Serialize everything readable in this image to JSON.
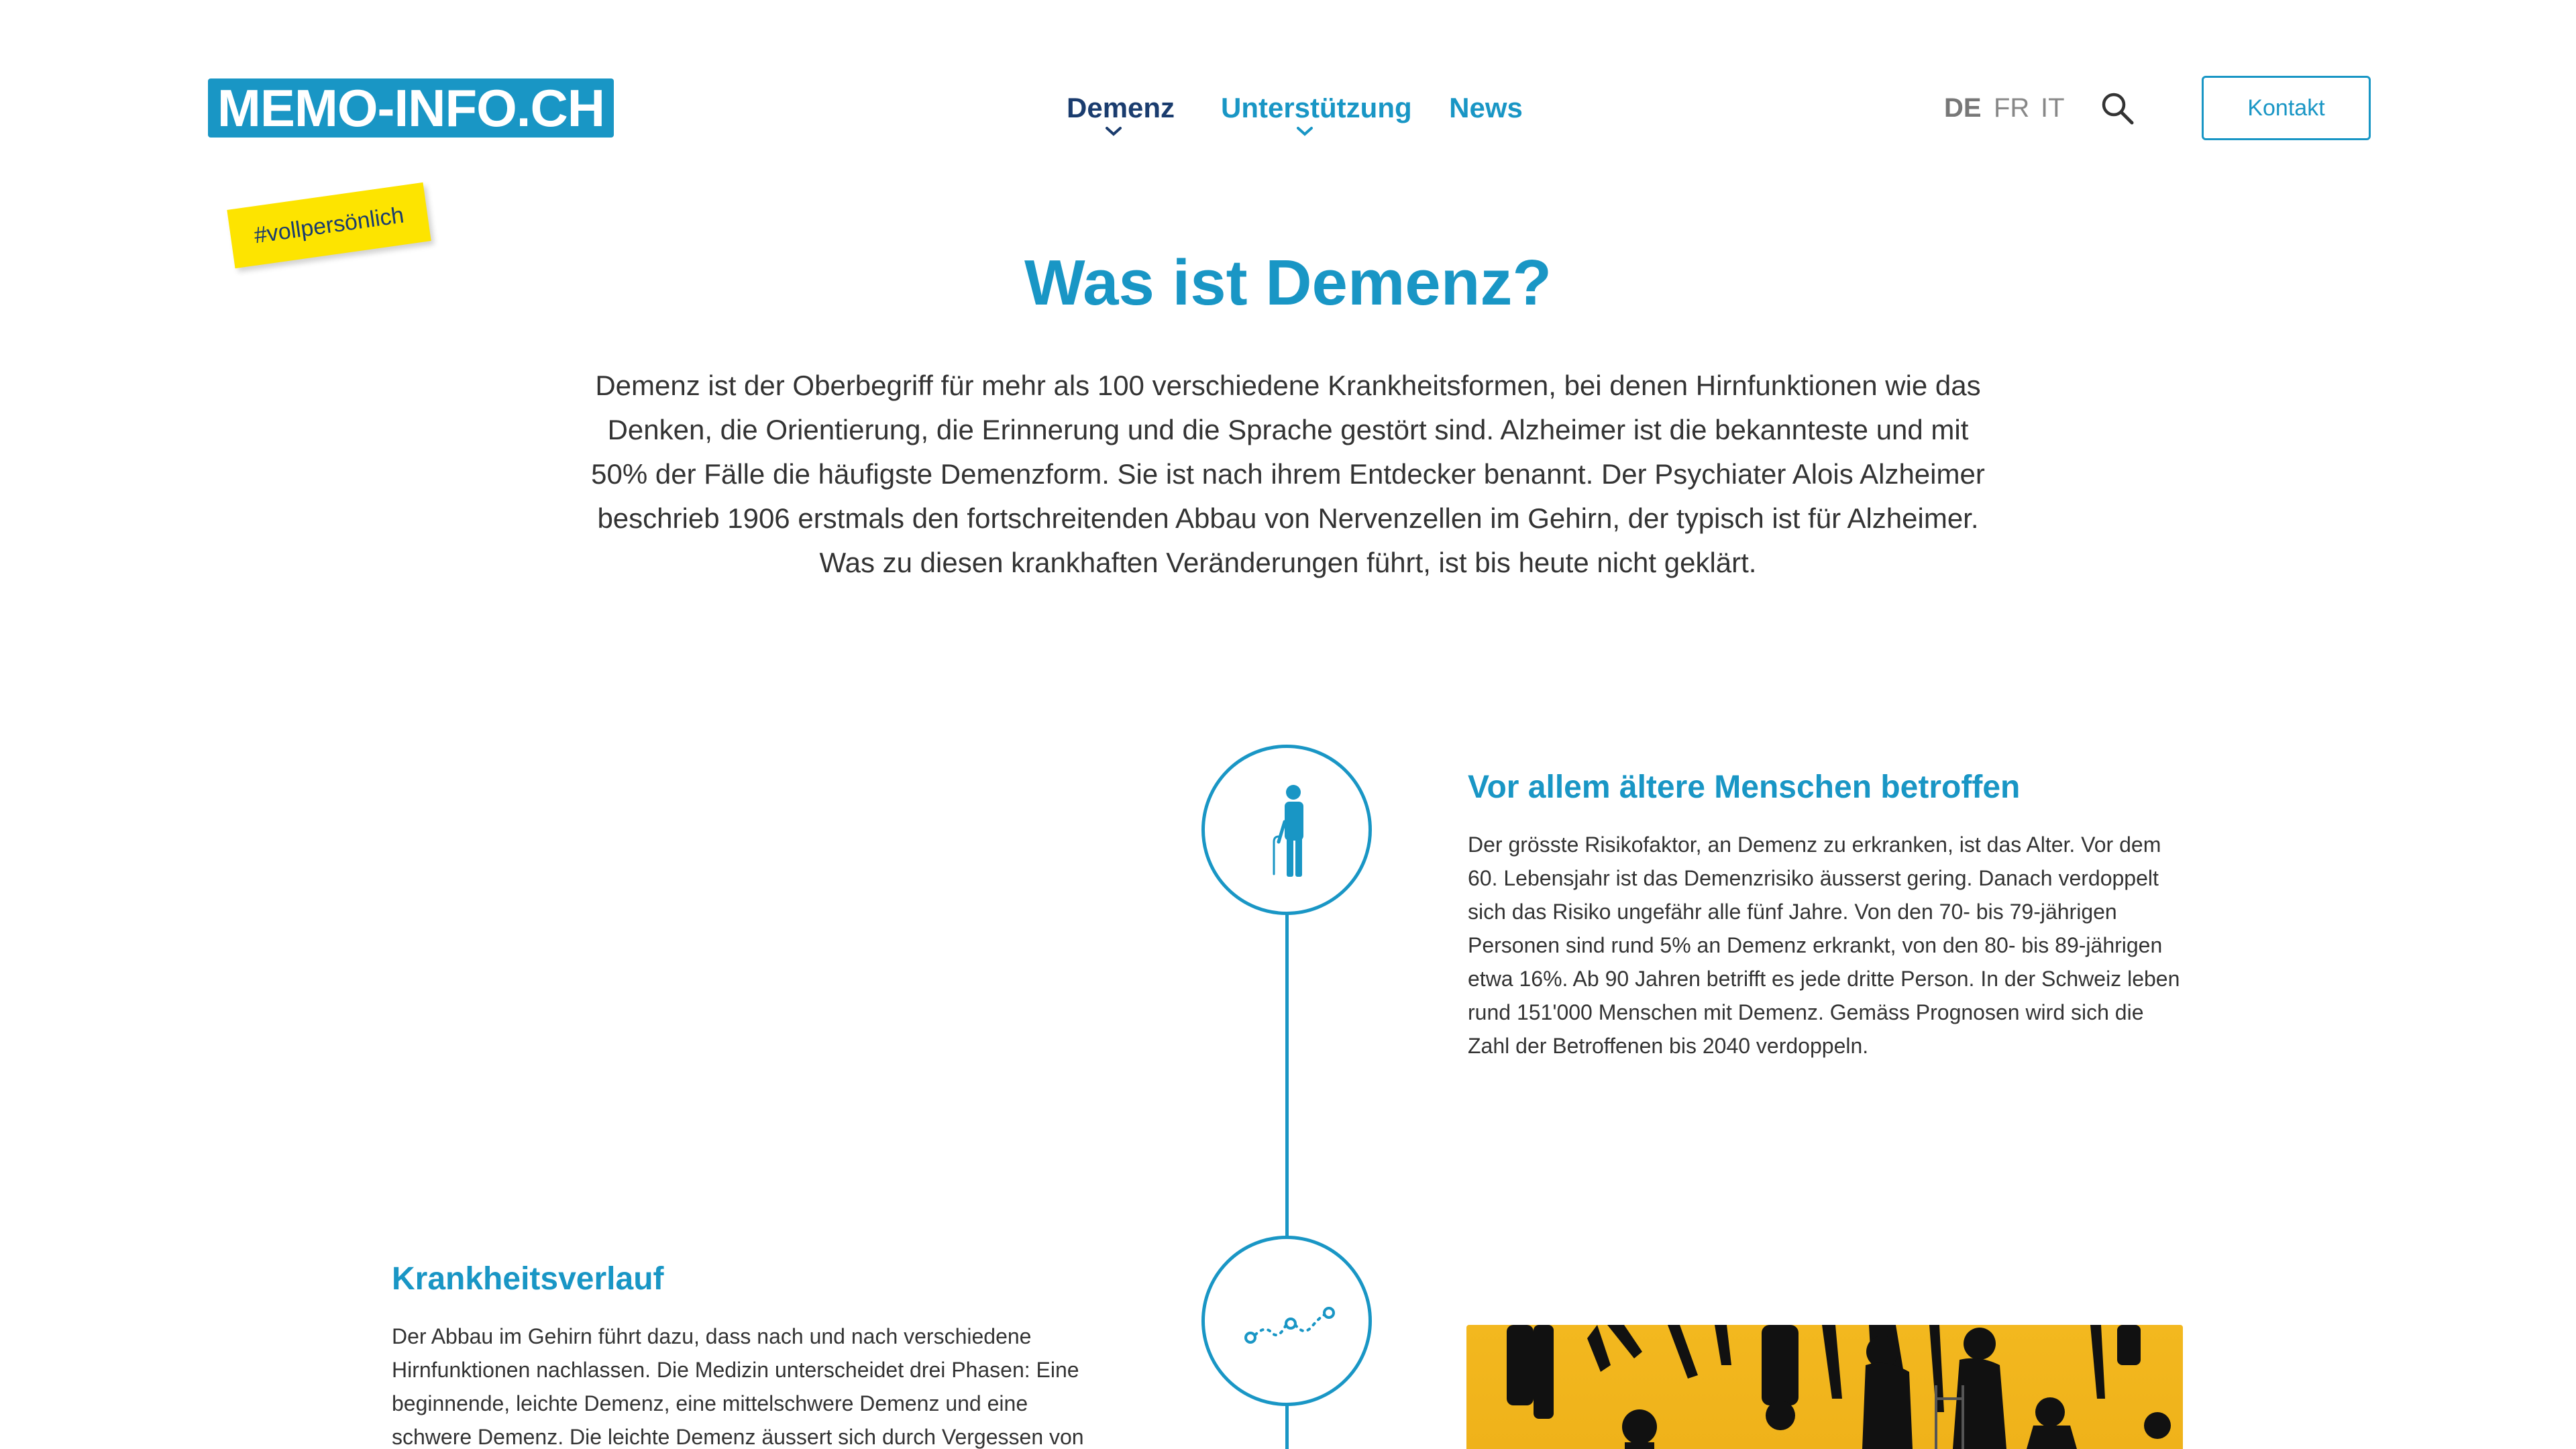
{
  "header": {
    "logo": "MEMO-INFO.CH",
    "sticker": "#vollpersönlich",
    "nav": [
      {
        "label": "Demenz",
        "has_dropdown": true,
        "active": true
      },
      {
        "label": "Unterstützung",
        "has_dropdown": true,
        "active": false
      },
      {
        "label": "News",
        "has_dropdown": false,
        "active": false
      }
    ],
    "languages": [
      "DE",
      "FR",
      "IT"
    ],
    "active_language": "DE",
    "search_icon": "search-icon",
    "contact_label": "Kontakt"
  },
  "main": {
    "title": "Was ist Demenz?",
    "intro": "Demenz ist der Oberbegriff für mehr als 100 verschiedene Krankheitsformen, bei denen Hirnfunktionen wie das Denken, die Orientierung, die Erinnerung und die Sprache gestört sind. Alzheimer ist die bekannteste und mit 50% der Fälle die häufigste Demenzform. Sie ist nach ihrem Entdecker benannt. Der Psychiater Alois Alzheimer beschrieb 1906 erstmals den fortschreitenden Abbau von Nervenzellen im Gehirn, der typisch ist für Alzheimer. Was zu diesen krankhaften Veränderungen führt, ist bis heute nicht geklärt.",
    "sections": [
      {
        "icon": "elderly-person-icon",
        "title": "Vor allem ältere Menschen betroffen",
        "text": "Der grösste Risikofaktor, an Demenz zu erkranken, ist das Alter. Vor dem 60. Lebensjahr ist das Demenzrisiko äusserst gering. Danach verdoppelt sich das Risiko ungefähr alle fünf Jahre. Von den 70- bis 79-jährigen Personen sind rund 5% an Demenz erkrankt, von den 80- bis 89-jährigen etwa 16%. Ab 90 Jahren betrifft es jede dritte Person. In der Schweiz leben rund 151'000 Menschen mit Demenz. Gemäss Prognosen wird sich die Zahl der Betroffenen bis 2040 verdoppeln."
      },
      {
        "icon": "progression-path-icon",
        "title": "Krankheitsverlauf",
        "text": "Der Abbau im Gehirn führt dazu, dass nach und nach verschiedene Hirnfunktionen nachlassen. Die Medizin unterscheidet drei Phasen: Eine beginnende, leichte Demenz, eine mittelschwere Demenz und eine schwere Demenz. Die leichte Demenz äussert sich durch Vergessen von"
      }
    ]
  },
  "colors": {
    "primary": "#1996c5",
    "nav_active": "#1a3c6e",
    "sticker": "#fde400",
    "image_background": "#f3b81f"
  }
}
